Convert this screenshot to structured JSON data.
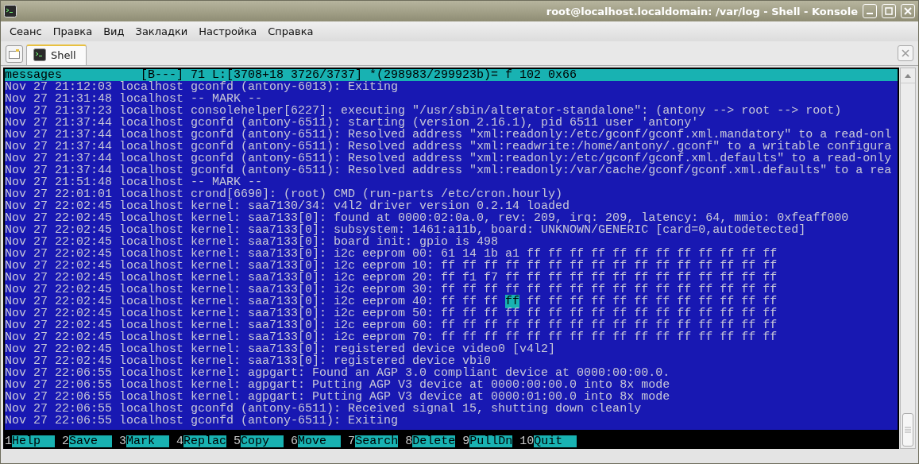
{
  "window": {
    "title": "root@localhost.localdomain: /var/log - Shell - Konsole"
  },
  "menu": [
    "Сеанс",
    "Правка",
    "Вид",
    "Закладки",
    "Настройка",
    "Справка"
  ],
  "tabs": [
    {
      "label": "Shell",
      "selected": true
    }
  ],
  "viewer": {
    "status": "messages           [B---] 71 L:[3708+18 3726/3737] *(298983/299923b)= f 102 0x66",
    "lines": [
      {
        "kind": "text",
        "text": "Nov 27 21:12:03 localhost gconfd (antony-6013): Exiting"
      },
      {
        "kind": "text",
        "text": "Nov 27 21:31:48 localhost -- MARK --"
      },
      {
        "kind": "text",
        "text": "Nov 27 21:37:23 localhost consolehelper[6227]: executing \"/usr/sbin/alterator-standalone\": (antony --> root --> root)"
      },
      {
        "kind": "text",
        "text": "Nov 27 21:37:44 localhost gconfd (antony-6511): starting (version 2.16.1), pid 6511 user 'antony'"
      },
      {
        "kind": "text",
        "text": "Nov 27 21:37:44 localhost gconfd (antony-6511): Resolved address \"xml:readonly:/etc/gconf/gconf.xml.mandatory\" to a read-onl"
      },
      {
        "kind": "text",
        "text": "Nov 27 21:37:44 localhost gconfd (antony-6511): Resolved address \"xml:readwrite:/home/antony/.gconf\" to a writable configura"
      },
      {
        "kind": "text",
        "text": "Nov 27 21:37:44 localhost gconfd (antony-6511): Resolved address \"xml:readonly:/etc/gconf/gconf.xml.defaults\" to a read-only"
      },
      {
        "kind": "text",
        "text": "Nov 27 21:37:44 localhost gconfd (antony-6511): Resolved address \"xml:readonly:/var/cache/gconf/gconf.xml.defaults\" to a rea"
      },
      {
        "kind": "text",
        "text": "Nov 27 21:51:48 localhost -- MARK --"
      },
      {
        "kind": "text",
        "text": "Nov 27 22:01:01 localhost crond[6690]: (root) CMD (run-parts /etc/cron.hourly)"
      },
      {
        "kind": "text",
        "text": "Nov 27 22:02:45 localhost kernel: saa7130/34: v4l2 driver version 0.2.14 loaded"
      },
      {
        "kind": "text",
        "text": "Nov 27 22:02:45 localhost kernel: saa7133[0]: found at 0000:02:0a.0, rev: 209, irq: 209, latency: 64, mmio: 0xfeaff000"
      },
      {
        "kind": "text",
        "text": "Nov 27 22:02:45 localhost kernel: saa7133[0]: subsystem: 1461:a11b, board: UNKNOWN/GENERIC [card=0,autodetected]"
      },
      {
        "kind": "text",
        "text": "Nov 27 22:02:45 localhost kernel: saa7133[0]: board init: gpio is 498"
      },
      {
        "kind": "text",
        "text": "Nov 27 22:02:45 localhost kernel: saa7133[0]: i2c eeprom 00: 61 14 1b a1 ff ff ff ff ff ff ff ff ff ff ff ff"
      },
      {
        "kind": "text",
        "text": "Nov 27 22:02:45 localhost kernel: saa7133[0]: i2c eeprom 10: ff ff ff ff ff ff ff ff ff ff ff ff ff ff ff ff"
      },
      {
        "kind": "text",
        "text": "Nov 27 22:02:45 localhost kernel: saa7133[0]: i2c eeprom 20: ff f1 f7 ff ff ff ff ff ff ff ff ff ff ff ff ff"
      },
      {
        "kind": "text",
        "text": "Nov 27 22:02:45 localhost kernel: saa7133[0]: i2c eeprom 30: ff ff ff ff ff ff ff ff ff ff ff ff ff ff ff ff"
      },
      {
        "kind": "cursor",
        "before": "Nov 27 22:02:45 localhost kernel: saa7133[0]: i2c eeprom 40: ff ff ff ",
        "cursor": "ff",
        "after": " ff ff ff ff ff ff ff ff ff ff ff ff"
      },
      {
        "kind": "text",
        "text": "Nov 27 22:02:45 localhost kernel: saa7133[0]: i2c eeprom 50: ff ff ff ff ff ff ff ff ff ff ff ff ff ff ff ff"
      },
      {
        "kind": "text",
        "text": "Nov 27 22:02:45 localhost kernel: saa7133[0]: i2c eeprom 60: ff ff ff ff ff ff ff ff ff ff ff ff ff ff ff ff"
      },
      {
        "kind": "text",
        "text": "Nov 27 22:02:45 localhost kernel: saa7133[0]: i2c eeprom 70: ff ff ff ff ff ff ff ff ff ff ff ff ff ff ff ff"
      },
      {
        "kind": "text",
        "text": "Nov 27 22:02:45 localhost kernel: saa7133[0]: registered device video0 [v4l2]"
      },
      {
        "kind": "text",
        "text": "Nov 27 22:02:45 localhost kernel: saa7133[0]: registered device vbi0"
      },
      {
        "kind": "text",
        "text": "Nov 27 22:06:55 localhost kernel: agpgart: Found an AGP 3.0 compliant device at 0000:00:00.0."
      },
      {
        "kind": "text",
        "text": "Nov 27 22:06:55 localhost kernel: agpgart: Putting AGP V3 device at 0000:00:00.0 into 8x mode"
      },
      {
        "kind": "text",
        "text": "Nov 27 22:06:55 localhost kernel: agpgart: Putting AGP V3 device at 0000:01:00.0 into 8x mode"
      },
      {
        "kind": "text",
        "text": "Nov 27 22:06:55 localhost gconfd (antony-6511): Received signal 15, shutting down cleanly"
      },
      {
        "kind": "text",
        "text": "Nov 27 22:06:55 localhost gconfd (antony-6511): Exiting"
      }
    ],
    "function_keys": [
      {
        "key": "1",
        "label": "Help"
      },
      {
        "key": "2",
        "label": "Save"
      },
      {
        "key": "3",
        "label": "Mark"
      },
      {
        "key": "4",
        "label": "Replac"
      },
      {
        "key": "5",
        "label": "Copy"
      },
      {
        "key": "6",
        "label": "Move"
      },
      {
        "key": "7",
        "label": "Search"
      },
      {
        "key": "8",
        "label": "Delete"
      },
      {
        "key": "9",
        "label": "PullDn"
      },
      {
        "key": "10",
        "label": "Quit"
      }
    ]
  }
}
